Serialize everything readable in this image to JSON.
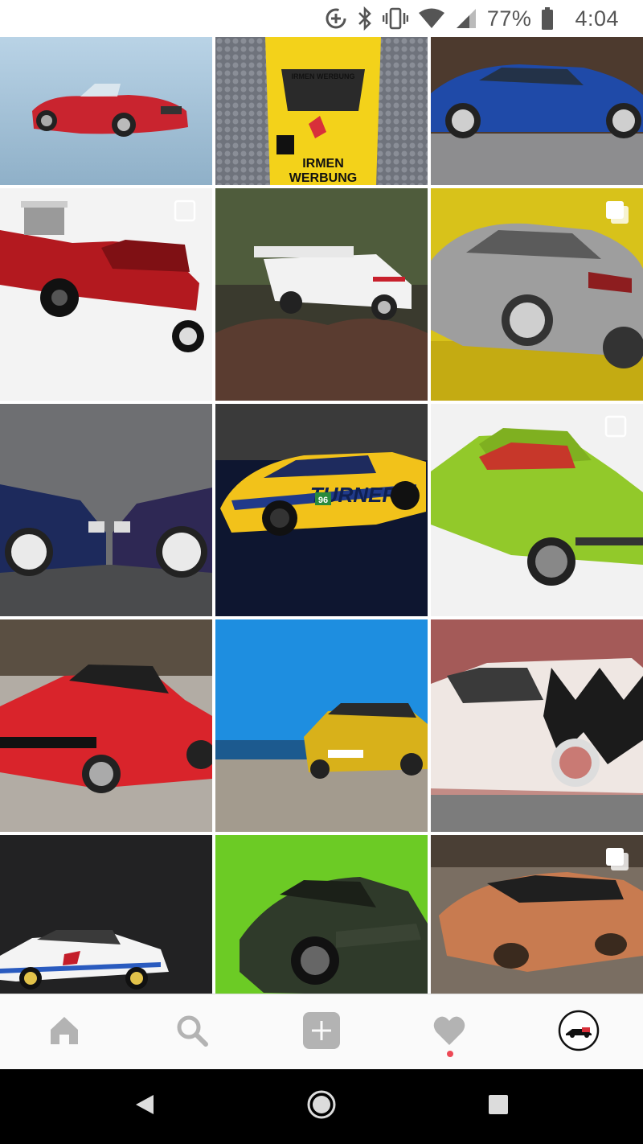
{
  "status_bar": {
    "battery_percent_text": "77%",
    "time": "4:04",
    "icons": [
      "data-saver-icon",
      "bluetooth-icon",
      "vibrate-icon",
      "wifi-icon",
      "cellular-signal-icon",
      "battery-icon"
    ]
  },
  "grid": {
    "tiles": [
      {
        "subject": "red roadster on blue background",
        "multi": false
      },
      {
        "subject": "yellow race car front",
        "multi": false
      },
      {
        "subject": "blue sedan",
        "multi": false
      },
      {
        "subject": "red hot rod with exposed engine",
        "multi": true
      },
      {
        "subject": "white race car on rock",
        "multi": false
      },
      {
        "subject": "silver sedan on yellow background",
        "multi": true
      },
      {
        "subject": "two blue cars facing each other",
        "multi": false
      },
      {
        "subject": "yellow race car",
        "multi": false
      },
      {
        "subject": "lime green coupe",
        "multi": true
      },
      {
        "subject": "red coupe on gravel",
        "multi": false
      },
      {
        "subject": "yellow coupe on beach",
        "multi": false
      },
      {
        "subject": "checkered art car",
        "multi": false
      },
      {
        "subject": "white race car on black",
        "multi": false
      },
      {
        "subject": "dark coupe on green",
        "multi": false
      },
      {
        "subject": "copper concept car",
        "multi": true
      }
    ],
    "tile_texts": {
      "tile2_top": "IRMEN WERBUNG",
      "tile2_bottom1": "IRMEN",
      "tile2_bottom2": "WERBUNG",
      "tile8_livery": "TURNER",
      "tile8_number": "96"
    }
  },
  "bottom_nav": {
    "items": [
      "home-icon",
      "search-icon",
      "new-post-icon",
      "activity-heart-icon",
      "profile-avatar"
    ],
    "activity_has_notification": true,
    "colors": {
      "icon": "#b3b3b3",
      "notification": "#ed4956"
    }
  },
  "android_nav": {
    "items": [
      "back-icon",
      "home-circle-icon",
      "recents-icon"
    ]
  }
}
